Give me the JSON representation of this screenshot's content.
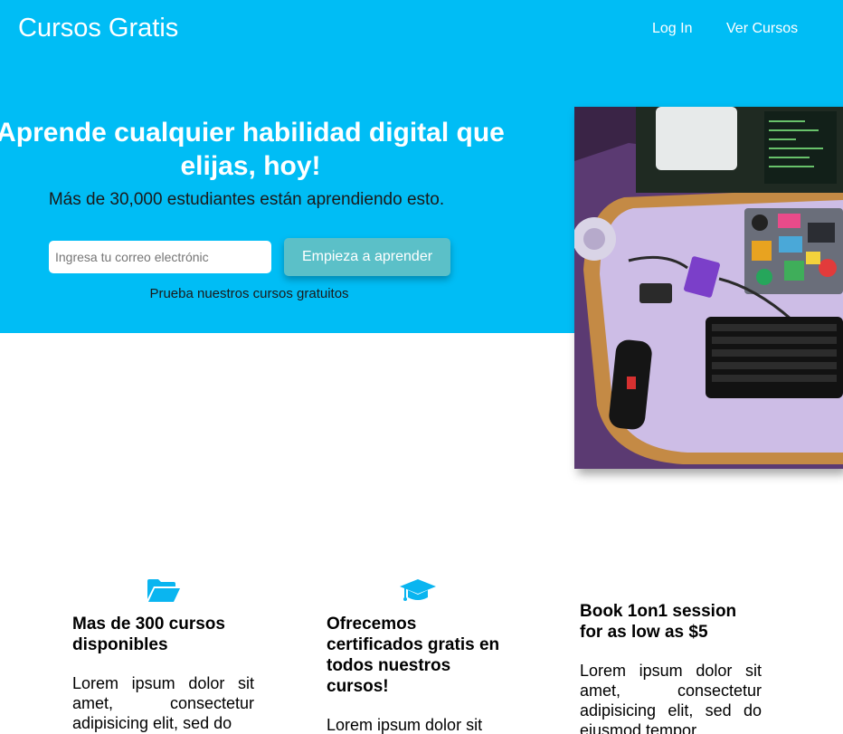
{
  "header": {
    "brand": "Cursos Gratis",
    "nav": [
      {
        "label": "Log In"
      },
      {
        "label": "Ver Cursos"
      }
    ]
  },
  "hero": {
    "title": "Aprende cualquier habilidad digital que elijas, hoy!",
    "subtitle": "Más de 30,000 estudiantes están aprendiendo esto.",
    "email_placeholder": "Ingresa tu correo electrónic",
    "cta_label": "Empieza a aprender",
    "trial_link": "Prueba nuestros cursos gratuitos"
  },
  "features": [
    {
      "icon": "folder-open-icon",
      "title": "Mas de 300 cursos disponibles",
      "text": "Lorem ipsum dolor sit amet, consectetur adipisicing elit, sed do"
    },
    {
      "icon": "graduation-cap-icon",
      "title": "Ofrecemos certificados gratis en todos nuestros cursos!",
      "text": "Lorem ipsum dolor sit"
    },
    {
      "title": "Book 1on1 session for as low as $5",
      "text": "Lorem ipsum dolor sit amet, consectetur adipisicing elit, sed do eiusmod tempor"
    }
  ],
  "colors": {
    "hero_background": "#00bdf5",
    "cta_button": "#5bc0c8",
    "icon_accent": "#0ab5f0"
  }
}
